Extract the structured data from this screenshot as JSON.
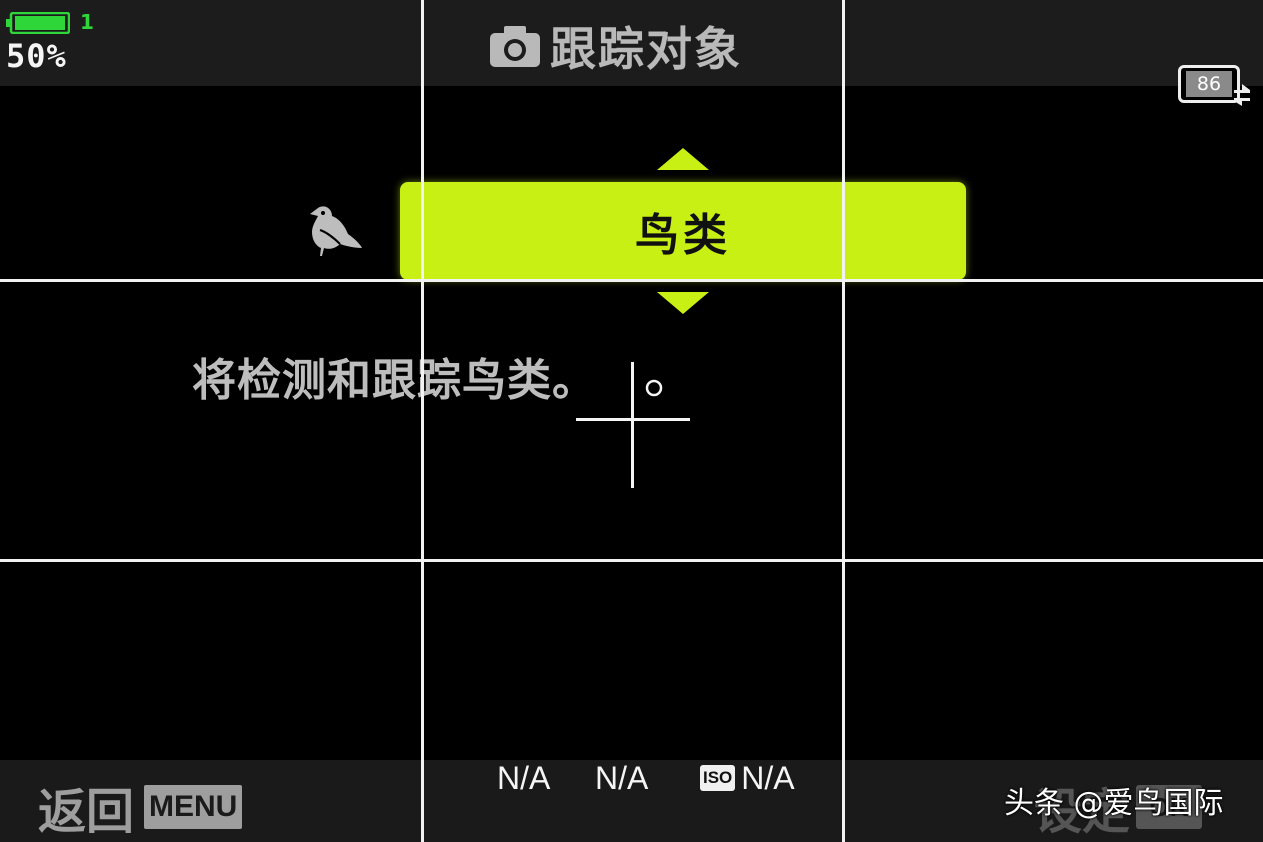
{
  "status": {
    "battery_percent_text": "50%",
    "battery_level": 0.5,
    "battery_slot": "1",
    "battery_color": "#2fd63a",
    "card_icon": "memory-card-icon",
    "card_count": "86"
  },
  "header": {
    "camera_icon": "camera-icon",
    "title": "跟踪对象"
  },
  "selector": {
    "icon": "bird-icon",
    "selected_option": "鸟类",
    "highlight_color": "#c8f015",
    "up_icon": "triangle-up-icon",
    "down_icon": "triangle-down-icon"
  },
  "description": "将检测和跟踪鸟类。",
  "exposure": {
    "shutter": "N/A",
    "aperture": "N/A",
    "iso_badge": "ISO",
    "iso_value": "N/A"
  },
  "footer": {
    "back_label": "返回",
    "back_key": "MENU",
    "set_label": "设定",
    "set_key": "OK"
  },
  "watermark": "头条 @爱鸟国际"
}
